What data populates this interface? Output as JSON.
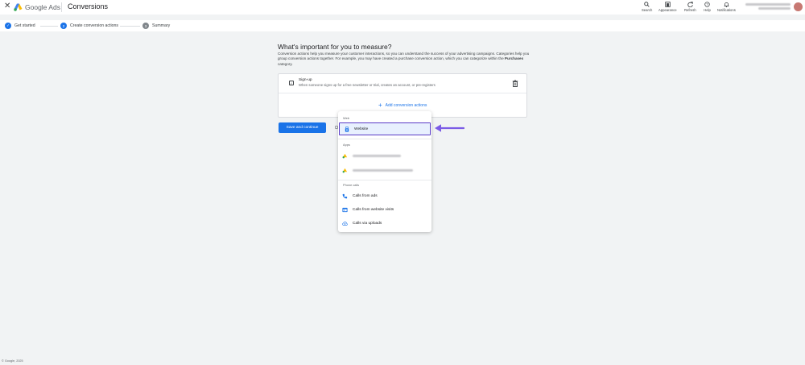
{
  "topbar": {
    "close_glyph": "✕",
    "brand": "Google Ads",
    "page_name": "Conversions",
    "tools": [
      {
        "label": "Search",
        "icon": "search-icon"
      },
      {
        "label": "Appearance",
        "icon": "appearance-icon"
      },
      {
        "label": "Refresh",
        "icon": "refresh-icon"
      },
      {
        "label": "Help",
        "icon": "help-icon"
      },
      {
        "label": "Notifications",
        "icon": "bell-icon"
      }
    ]
  },
  "steps": [
    {
      "number": "✓",
      "label": "Get started",
      "state": "done"
    },
    {
      "number": "2",
      "label": "Create conversion actions",
      "state": "active"
    },
    {
      "number": "3",
      "label": "Summary",
      "state": "todo"
    }
  ],
  "main": {
    "heading": "What's important for you to measure?",
    "desc_part1": "Conversion actions help you measure your customer interactions, so you can understand the success of your advertising campaigns. Categories help you group conversion actions together. For example, you may have created a purchase conversion action, which you can categorize within the ",
    "desc_bold": "Purchases",
    "desc_part2": " category."
  },
  "card": {
    "row_title": "Sign-up",
    "row_desc": "When someone signs up for a free newsletter or trial, creates an account, or pre-registers",
    "add_label": "Add conversion actions"
  },
  "save_button": "Save and continue",
  "dropdown": {
    "web_label": "Web",
    "website": "Website",
    "apps_label": "Apps",
    "phone_label": "Phone calls",
    "calls_from_ads": "Calls from ads",
    "calls_from_website": "Calls from website visits",
    "calls_via_uploads": "Calls via uploads"
  },
  "colors": {
    "accent": "#1a73e8",
    "highlight_border": "#5a3bc7",
    "arrow": "#7b5be6"
  },
  "footer": "© Google, 2025"
}
